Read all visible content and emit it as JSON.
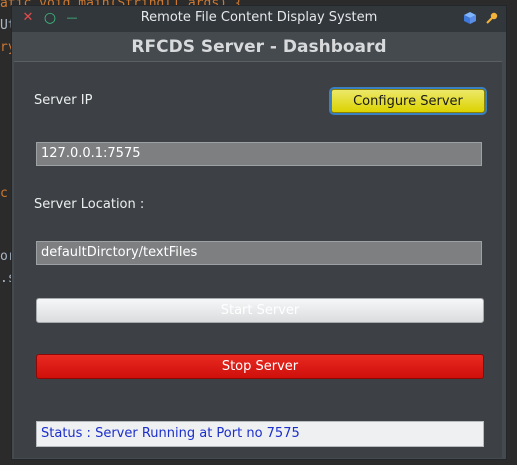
{
  "background_code": {
    "line1": "atic void main(String[] args) {",
    "line2": "Ut",
    "line3": "ry",
    "line4": "c",
    "line5": "or",
    "line6": ".s"
  },
  "window": {
    "title": "Remote File Content Display System",
    "close_glyph": "✕",
    "restore_glyph": "○",
    "minimize_glyph": "—",
    "tray_icon1": "cube-icon",
    "tray_icon2": "pin-icon"
  },
  "dashboard": {
    "heading": "RFCDS Server - Dashboard",
    "server_ip_label": "Server IP",
    "configure_button": "Configure Server",
    "server_ip_value": "127.0.0.1:7575",
    "server_location_label": "Server Location :",
    "server_location_value": "defaultDirctory/textFiles",
    "start_button": "Start Server",
    "stop_button": "Stop Server",
    "status_text": "Status : Server Running at Port no 7575"
  },
  "colors": {
    "configure_button": "#dcd300",
    "stop_button": "#cf0f0a",
    "status_text": "#1c2ecc"
  }
}
